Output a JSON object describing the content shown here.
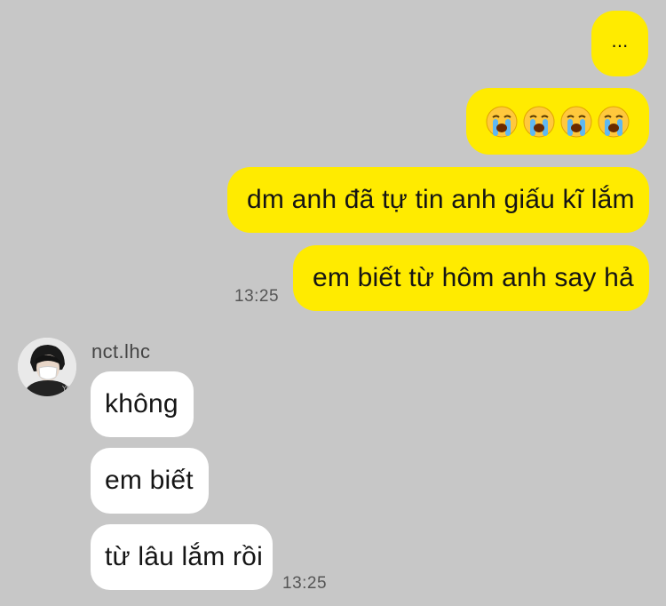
{
  "colors": {
    "background": "#c7c7c7",
    "outgoing_bubble": "#ffeb00",
    "incoming_bubble": "#ffffff"
  },
  "outgoing": {
    "msg1": "...",
    "msg2_emojis": [
      "loudly-crying-face",
      "loudly-crying-face",
      "loudly-crying-face",
      "loudly-crying-face"
    ],
    "msg3": "dm anh đã tự tin anh giấu kĩ lắm",
    "msg4": "em biết từ hôm anh say hả",
    "time": "13:25"
  },
  "incoming": {
    "sender": "nct.lhc",
    "avatar_icon": "profile-photo",
    "msg1": "không",
    "msg2": "em biết",
    "msg3": "từ lâu lắm rồi",
    "time": "13:25"
  }
}
